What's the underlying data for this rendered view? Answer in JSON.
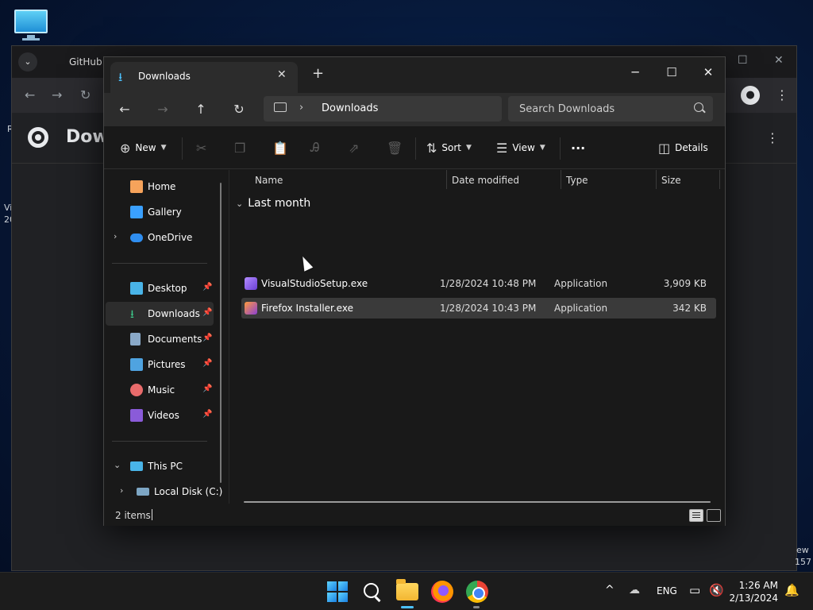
{
  "background": {
    "left_fragments": [
      "R",
      "Vi",
      "20"
    ],
    "right_fragments": [
      "ew",
      "157"
    ]
  },
  "chrome": {
    "tab_title": "GitHub -",
    "page_title": "Down",
    "menu_glyph": "⌄"
  },
  "explorer": {
    "tab_title": "Downloads",
    "new_tab": "+",
    "path": {
      "current": "Downloads"
    },
    "search": {
      "placeholder": "Search Downloads"
    },
    "commands": {
      "new_label": "New",
      "sort_label": "Sort",
      "view_label": "View",
      "more_label": "···",
      "details_label": "Details"
    },
    "nav": {
      "quick": [
        {
          "label": "Home",
          "icon": "home-icon",
          "color": "#f6a35b"
        },
        {
          "label": "Gallery",
          "icon": "gallery-icon",
          "color": "#3aa0ff"
        },
        {
          "label": "OneDrive",
          "icon": "cloud-icon",
          "color": "#2f8ef0"
        }
      ],
      "pinned": [
        {
          "label": "Desktop",
          "icon": "desktop-icon",
          "color": "#49b4e8"
        },
        {
          "label": "Downloads",
          "icon": "download-icon",
          "color": "#3dc98a"
        },
        {
          "label": "Documents",
          "icon": "documents-icon",
          "color": "#8aa9c8"
        },
        {
          "label": "Pictures",
          "icon": "pictures-icon",
          "color": "#4fa3e0"
        },
        {
          "label": "Music",
          "icon": "music-icon",
          "color": "#e86b6b"
        },
        {
          "label": "Videos",
          "icon": "videos-icon",
          "color": "#8a5bd9"
        }
      ],
      "this_pc": "This PC",
      "local_disk": "Local Disk (C:)"
    },
    "columns": [
      "Name",
      "Date modified",
      "Type",
      "Size"
    ],
    "group": "Last month",
    "files": [
      {
        "name": "VisualStudioSetup.exe",
        "date": "1/28/2024 10:48 PM",
        "type": "Application",
        "size": "3,909 KB"
      },
      {
        "name": "Firefox Installer.exe",
        "date": "1/28/2024 10:43 PM",
        "type": "Application",
        "size": "342 KB"
      }
    ],
    "status": "2 items"
  },
  "taskbar": {
    "language": "ENG",
    "time": "1:26 AM",
    "date": "2/13/2024"
  },
  "colors": {
    "accent": "#4cc2ff",
    "selection": "#3a3a3a"
  }
}
